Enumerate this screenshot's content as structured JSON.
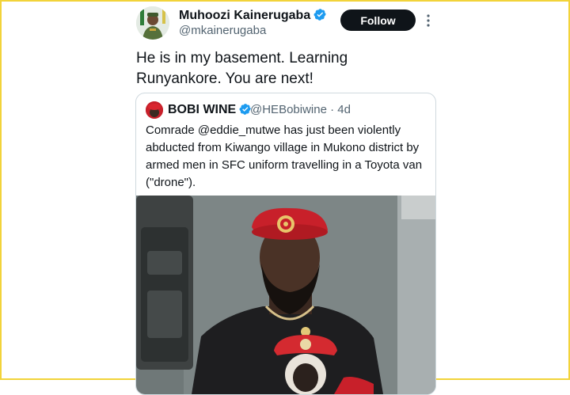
{
  "tweet": {
    "author": {
      "name": "Muhoozi Kainerugaba",
      "handle": "@mkainerugaba",
      "verified": true
    },
    "follow_label": "Follow",
    "more_icon": "more-vertical-icon",
    "text": "He is in my basement. Learning Runyankore. You are next!"
  },
  "quoted_tweet": {
    "author": {
      "name": "BOBI WINE",
      "handle": "@HEBobiwine",
      "verified": true
    },
    "separator": "·",
    "time": "4d",
    "text": "Comrade @eddie_mutwe has just been violently abducted from Kiwango village in Mukono district by armed men in SFC uniform travelling in a Toyota van (\"drone\")."
  },
  "colors": {
    "border_highlight": "#f2d33a",
    "verified_blue": "#1d9bf0",
    "follow_bg": "#0f1419",
    "secondary_text": "#536471",
    "beret_red": "#c8202a"
  }
}
